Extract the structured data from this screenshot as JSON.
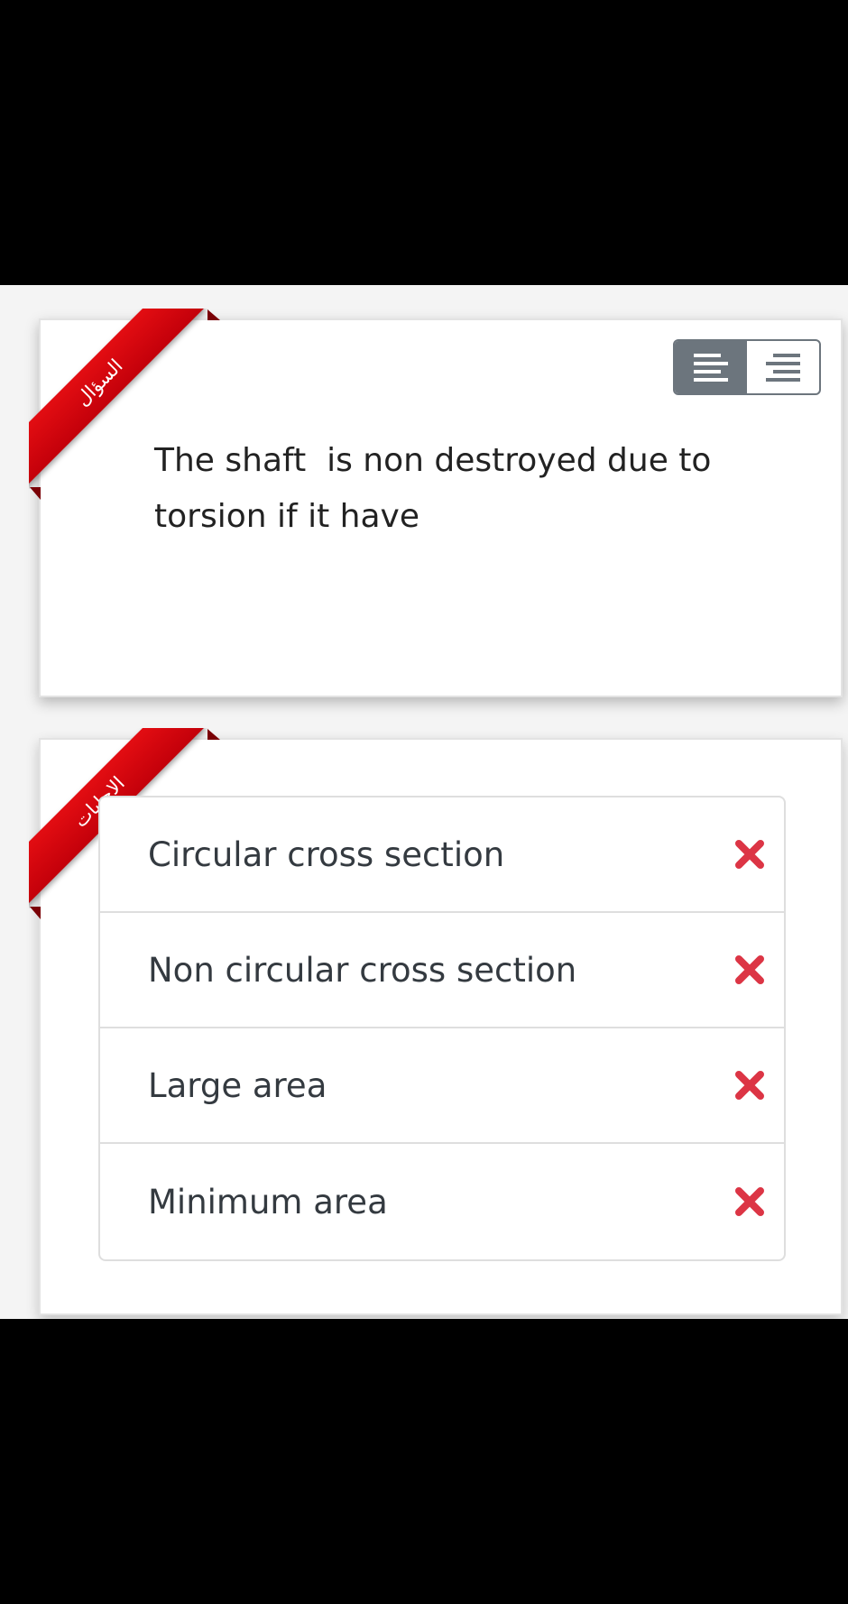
{
  "question_card": {
    "ribbon_label": "السؤال",
    "text": "The shaft  is non destroyed due to\ntorsion if it have",
    "align_toggle": {
      "options": [
        "align-left",
        "align-right"
      ],
      "active": "align-left"
    }
  },
  "answers_card": {
    "ribbon_label": "الاجابات",
    "items": [
      {
        "label": "Circular cross section",
        "icon": "x-mark-icon"
      },
      {
        "label": "Non circular cross section",
        "icon": "x-mark-icon"
      },
      {
        "label": "Large area",
        "icon": "x-mark-icon"
      },
      {
        "label": "Minimum area",
        "icon": "x-mark-icon"
      }
    ]
  },
  "colors": {
    "ribbon": "#d4060e",
    "toggle_active": "#6c757d",
    "wrong_mark": "#dc3545",
    "background": "#000000"
  }
}
